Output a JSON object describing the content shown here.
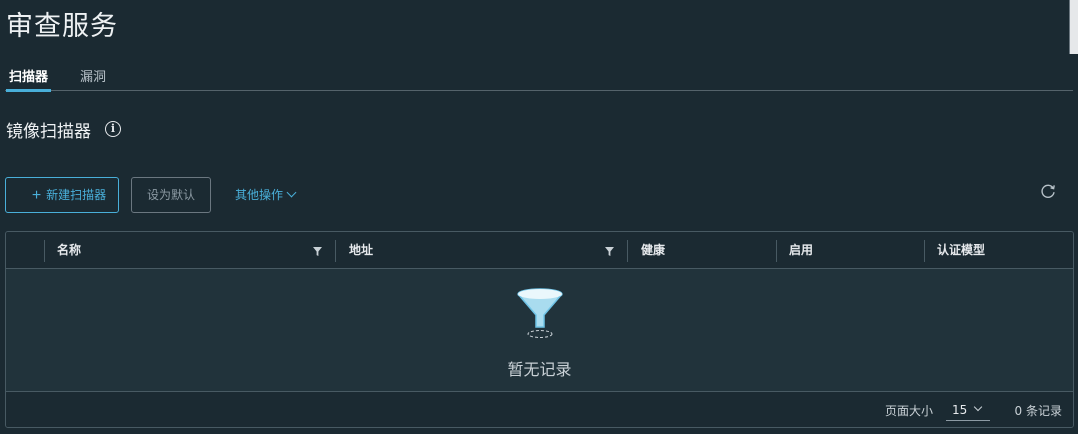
{
  "page": {
    "title": "审查服务"
  },
  "tabs": [
    {
      "label": "扫描器",
      "active": true
    },
    {
      "label": "漏洞",
      "active": false
    }
  ],
  "section": {
    "title": "镜像扫描器",
    "info_icon": "info-circle-icon"
  },
  "toolbar": {
    "new_label": "新建扫描器",
    "new_icon": "plus-icon",
    "set_default_label": "设为默认",
    "more_actions_label": "其他操作",
    "refresh_icon": "refresh-icon"
  },
  "grid": {
    "columns": [
      {
        "label": "名称",
        "filterable": true
      },
      {
        "label": "地址",
        "filterable": true
      },
      {
        "label": "健康",
        "filterable": false
      },
      {
        "label": "启用",
        "filterable": false
      },
      {
        "label": "认证模型",
        "filterable": false
      }
    ],
    "rows": [],
    "empty_text": "暂无记录",
    "empty_icon": "empty-funnel-icon"
  },
  "footer": {
    "page_size_label": "页面大小",
    "page_size_value": "15",
    "record_count": "0 条记录"
  },
  "colors": {
    "background": "#1b2a32",
    "accent": "#49afd9",
    "border": "#485a63"
  }
}
